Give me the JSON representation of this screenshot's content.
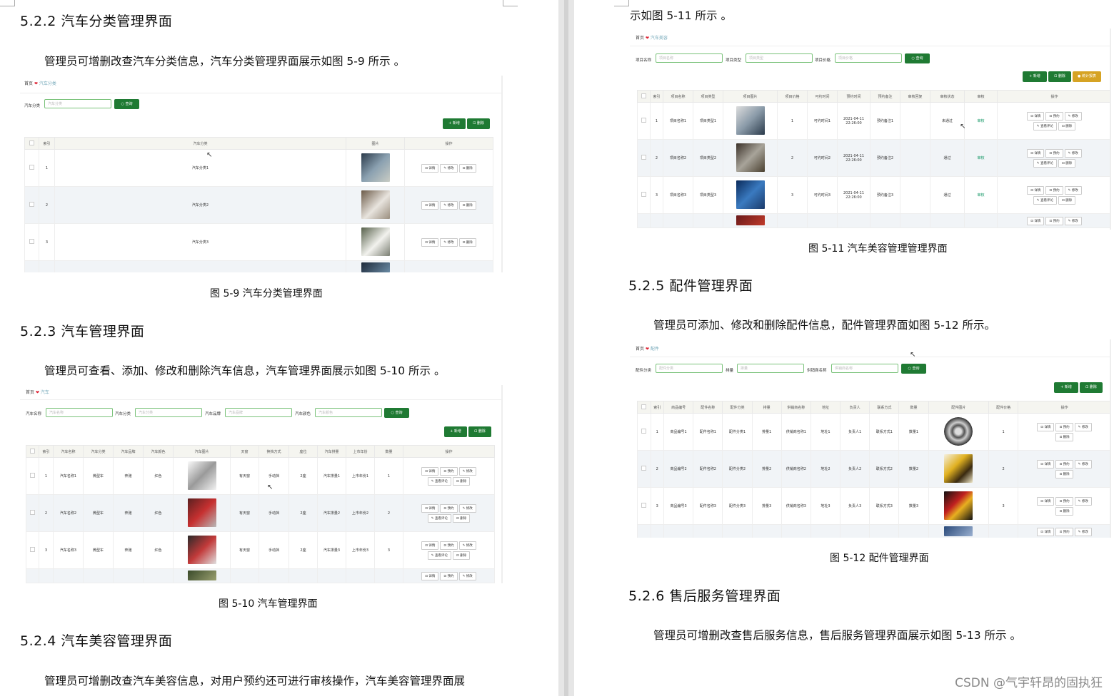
{
  "left": {
    "s522": {
      "heading": "5.2.2 汽车分类管理界面",
      "para": "管理员可增删改查汽车分类信息，汽车分类管理界面展示如图 5-9 所示 。",
      "caption": "图 5-9   汽车分类管理界面",
      "ui": {
        "crumb_home": "首页",
        "crumb_current": "汽车分类",
        "search_label": "汽车分类",
        "search_placeholder": "汽车分类",
        "search_btn": "○ 查询",
        "add_btn": "+ 新增",
        "del_btn": "⊡ 删除",
        "headers": [
          "索引",
          "汽车分类",
          "图片",
          "操作"
        ],
        "rows": [
          {
            "idx": "1",
            "name": "汽车分类1"
          },
          {
            "idx": "2",
            "name": "汽车分类2"
          },
          {
            "idx": "3",
            "name": "汽车分类3"
          }
        ],
        "actions": [
          "⊡ 详情",
          "✎ 修改",
          "⊡ 删除"
        ]
      }
    },
    "s523": {
      "heading": "5.2.3 汽车管理界面",
      "para": "管理员可查看、添加、修改和删除汽车信息，汽车管理界面展示如图 5-10 所示 。",
      "caption": "图 5-10   汽车管理界面",
      "ui": {
        "crumb_home": "首页",
        "crumb_current": "汽车",
        "filters": [
          {
            "label": "汽车名称",
            "placeholder": "汽车名称"
          },
          {
            "label": "汽车分类",
            "placeholder": "汽车分类"
          },
          {
            "label": "汽车品牌",
            "placeholder": "汽车品牌"
          },
          {
            "label": "汽车颜色",
            "placeholder": "汽车颜色"
          }
        ],
        "search_btn": "○ 查询",
        "add_btn": "+ 新增",
        "del_btn": "⊡ 删除",
        "headers": [
          "索引",
          "汽车名称",
          "汽车分类",
          "汽车品牌",
          "汽车颜色",
          "汽车图片",
          "天窗",
          "换挡方式",
          "座位",
          "汽车排量",
          "上市年份",
          "数量",
          "操作"
        ],
        "rows": [
          [
            "1",
            "汽车名称1",
            "微型车",
            "奔驰",
            "红色",
            "有天窗",
            "手动挡",
            "2座",
            "汽车排量1",
            "上市年份1",
            "1"
          ],
          [
            "2",
            "汽车名称2",
            "微型车",
            "奔驰",
            "红色",
            "有天窗",
            "手动挡",
            "2座",
            "汽车排量2",
            "上市年份2",
            "2"
          ],
          [
            "3",
            "汽车名称3",
            "微型车",
            "奔驰",
            "红色",
            "有天窗",
            "手动挡",
            "2座",
            "汽车排量3",
            "上市年份3",
            "3"
          ]
        ],
        "actions_row1": [
          "⊡ 详情",
          "⊡ 预约",
          "✎ 修改"
        ],
        "actions_row2": [
          "✎ 查看评论",
          "⊡ 删除"
        ]
      }
    },
    "s524": {
      "heading": "5.2.4 汽车美容管理界面",
      "para": "管理员可增删改查汽车美容信息，对用户预约还可进行审核操作，汽车美容管理界面展"
    }
  },
  "right": {
    "top_line": "示如图 5-11 所示 。",
    "fig511": {
      "caption": "图 5-11  汽车美容管理管理界面",
      "crumb_home": "首页",
      "crumb_current": "汽车美容",
      "filters": [
        {
          "label": "项目名称",
          "placeholder": "项目名称"
        },
        {
          "label": "项目类型",
          "placeholder": "项目类型"
        },
        {
          "label": "项目价格",
          "placeholder": "项目价格"
        }
      ],
      "search_btn": "○ 查询",
      "add_btn": "+ 新增",
      "del_btn": "⊡ 删除",
      "stat_btn": "● 统计报表",
      "headers": [
        "索引",
        "项目名称",
        "项目类型",
        "项目图片",
        "项目价格",
        "可约时间",
        "预约时间",
        "预约备注",
        "审核回复",
        "审核状态",
        "审核",
        "操作"
      ],
      "rows": [
        [
          "1",
          "项目名称1",
          "项目类型1",
          "1",
          "可约时间1",
          "2021-04-11 22:26:00",
          "预约备注1",
          "",
          "未通过",
          "审核"
        ],
        [
          "2",
          "项目名称2",
          "项目类型2",
          "2",
          "可约时间2",
          "2021-04-11 22:26:00",
          "预约备注2",
          "",
          "通过",
          "审核"
        ],
        [
          "3",
          "项目名称3",
          "项目类型3",
          "3",
          "可约时间3",
          "2021-04-11 22:26:00",
          "预约备注3",
          "",
          "通过",
          "审核"
        ]
      ],
      "actions_row1": [
        "⊡ 详情",
        "⊡ 预约",
        "✎ 修改"
      ],
      "actions_row2": [
        "✎ 查看评论",
        "⊡ 删除"
      ]
    },
    "s525": {
      "heading": "5.2.5 配件管理界面",
      "para": "管理员可添加、修改和删除配件信息，配件管理界面如图 5-12 所示。",
      "caption": "图 5-12  配件管理界面",
      "ui": {
        "crumb_home": "首页",
        "crumb_current": "配件",
        "filters": [
          {
            "label": "配件分类",
            "placeholder": "配件分类"
          },
          {
            "label": "排量",
            "placeholder": "排量"
          },
          {
            "label": "供销商名称",
            "placeholder": "供销商名称"
          }
        ],
        "search_btn": "○ 查询",
        "add_btn": "+ 新增",
        "del_btn": "⊡ 删除",
        "headers": [
          "索引",
          "商品编号",
          "配件名称",
          "配件分类",
          "排量",
          "供销商名称",
          "地址",
          "负责人",
          "联系方式",
          "数量",
          "配件图片",
          "配件价格",
          "操作"
        ],
        "rows": [
          [
            "1",
            "商品编号1",
            "配件名称1",
            "配件分类1",
            "排量1",
            "供销商名称1",
            "地址1",
            "负责人1",
            "联系方式1",
            "数量1",
            "1"
          ],
          [
            "2",
            "商品编号2",
            "配件名称2",
            "配件分类2",
            "排量2",
            "供销商名称2",
            "地址2",
            "负责人2",
            "联系方式2",
            "数量2",
            "2"
          ],
          [
            "3",
            "商品编号3",
            "配件名称3",
            "配件分类3",
            "排量3",
            "供销商名称3",
            "地址3",
            "负责人3",
            "联系方式3",
            "数量3",
            "3"
          ]
        ],
        "actions_row1": [
          "⊡ 详情",
          "⊡ 预约",
          "✎ 修改"
        ],
        "actions_row2": [
          "⊡ 删除"
        ]
      }
    },
    "s526": {
      "heading": "5.2.6 售后服务管理界面",
      "para": "管理员可增删改查售后服务信息，售后服务管理界面展示如图 5-13 所示 。"
    }
  },
  "watermark": "CSDN @气宇轩昂的固执狂",
  "colors": {
    "green": "#1f7a33",
    "yellow": "#d6a324",
    "heart": "#dd2233",
    "audit": "#1a9a6a"
  }
}
